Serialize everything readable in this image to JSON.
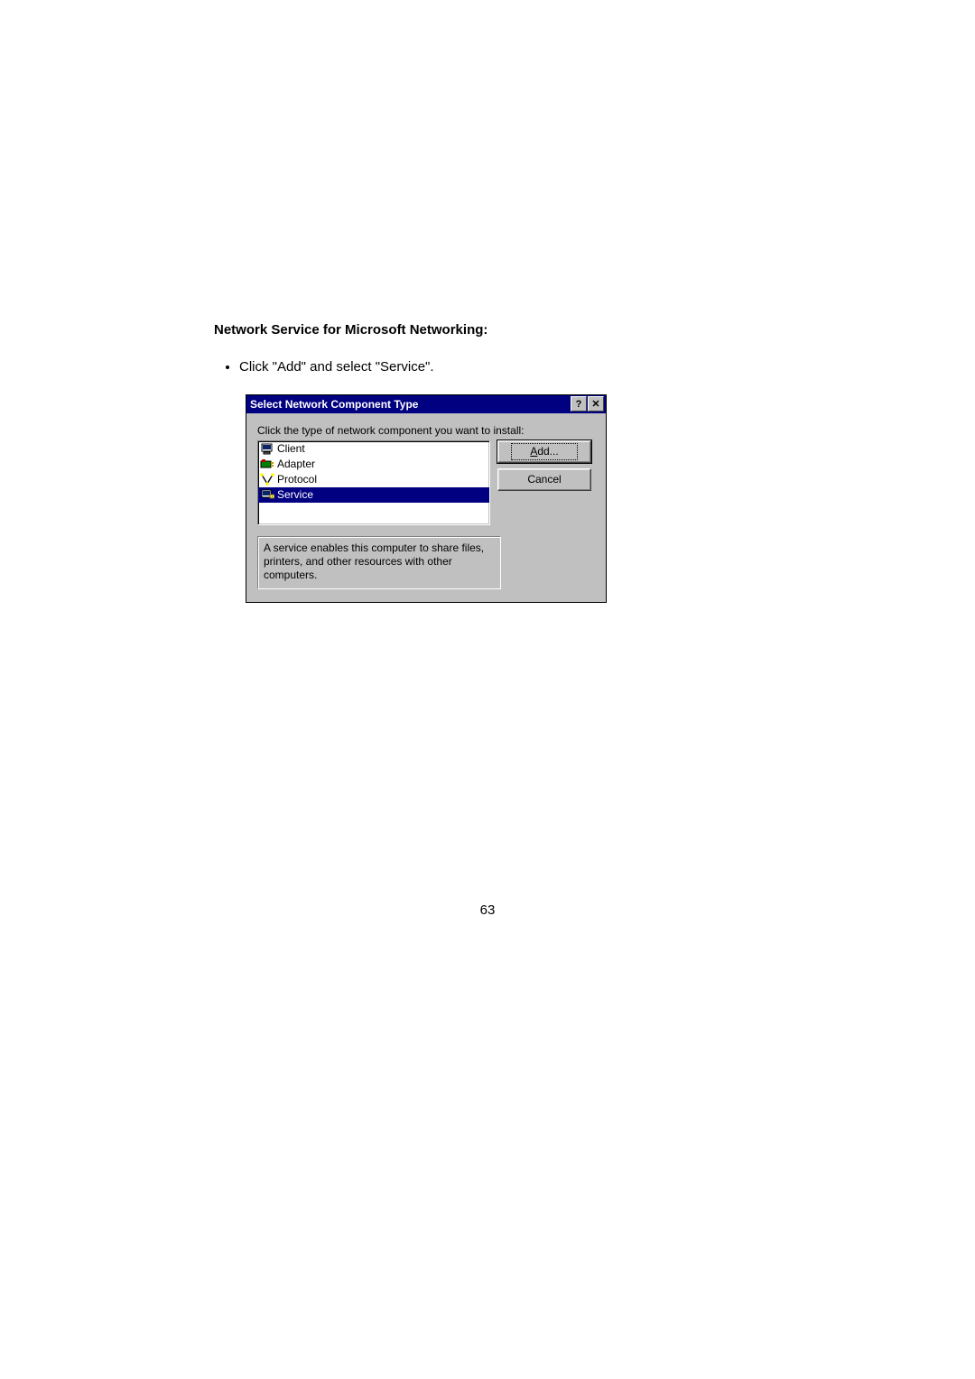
{
  "section_heading": "Network Service for Microsoft Networking:",
  "bullet_text": "Click \"Add\" and select \"Service\".",
  "dialog": {
    "title": "Select Network Component Type",
    "help_label": "?",
    "close_label": "✕",
    "instruction": "Click the type of network component you want to install:",
    "items": {
      "client": "Client",
      "adapter": "Adapter",
      "protocol": "Protocol",
      "service": "Service"
    },
    "buttons": {
      "add_underline": "A",
      "add_rest": "dd...",
      "cancel": "Cancel"
    },
    "description": "A service enables this computer to share files, printers, and other resources with other computers."
  },
  "page_number": "63"
}
